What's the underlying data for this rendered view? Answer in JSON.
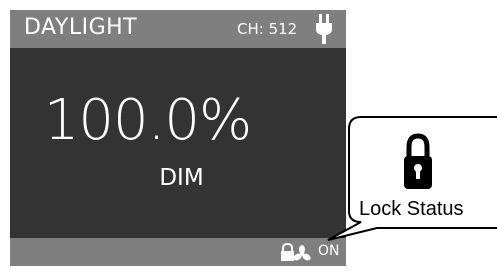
{
  "header": {
    "mode_title": "DAYLIGHT",
    "channel": "CH: 512",
    "power_icon": "plug-icon"
  },
  "main": {
    "value": "100.0%",
    "value_label": "DIM"
  },
  "footer": {
    "status_icon": "fan-lock-icon",
    "status_text": "ON"
  },
  "callout": {
    "icon": "padlock-icon",
    "label": "Lock Status"
  },
  "colors": {
    "screen_bg": "#333333",
    "bar_bg": "#7f7f7f",
    "text": "#ffffff"
  }
}
